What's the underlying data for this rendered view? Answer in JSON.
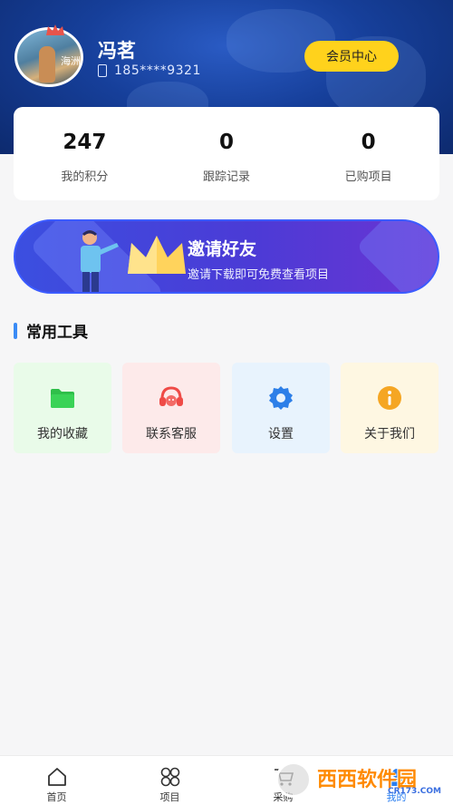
{
  "profile": {
    "name": "冯茗",
    "phone": "185****9321",
    "avatar_caption": "海洲",
    "member_button": "会员中心"
  },
  "stats": [
    {
      "value": "247",
      "label": "我的积分"
    },
    {
      "value": "0",
      "label": "跟踪记录"
    },
    {
      "value": "0",
      "label": "已购项目"
    }
  ],
  "invite": {
    "title": "邀请好友",
    "subtitle": "邀请下载即可免费查看项目"
  },
  "tools": {
    "title": "常用工具",
    "items": [
      {
        "label": "我的收藏",
        "icon": "folder-icon",
        "bg": "#e9fbe9",
        "color": "#2fbf4a"
      },
      {
        "label": "联系客服",
        "icon": "headset-icon",
        "bg": "#fdeaea",
        "color": "#ef4b47"
      },
      {
        "label": "设置",
        "icon": "gear-icon",
        "bg": "#e8f3fd",
        "color": "#2d7fe8"
      },
      {
        "label": "关于我们",
        "icon": "info-icon",
        "bg": "#fef7e2",
        "color": "#f5a623"
      }
    ]
  },
  "nav": {
    "items": [
      {
        "label": "首页",
        "icon": "home-icon"
      },
      {
        "label": "项目",
        "icon": "grid-icon"
      },
      {
        "label": "采购",
        "icon": "cart-icon"
      },
      {
        "label": "我的",
        "icon": "user-icon",
        "active": true
      }
    ]
  },
  "watermark": {
    "text": "西西软件园",
    "sub": "CR173.COM"
  },
  "colors": {
    "accent": "#2a7ef0",
    "member_button": "#ffd21c",
    "header_blue": "#163f9a",
    "invite_purple": "#4b3bd6"
  }
}
